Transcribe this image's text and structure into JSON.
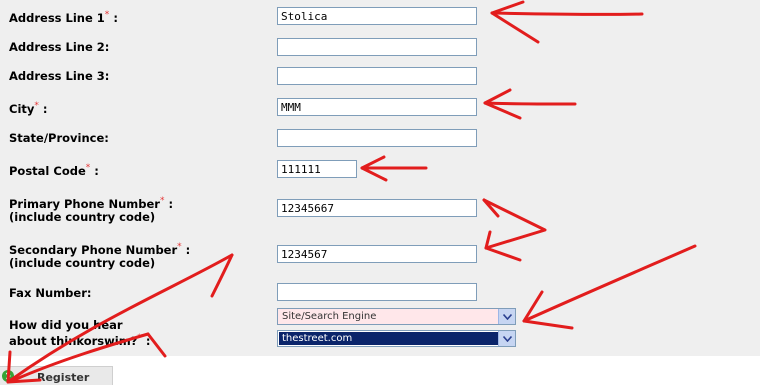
{
  "form": {
    "address1_label": "Address Line 1",
    "address1_value": "Stolica",
    "address2_label": "Address Line 2:",
    "address2_value": "",
    "address3_label": "Address Line 3:",
    "address3_value": "",
    "city_label": "City",
    "city_value": "MMM",
    "state_label": "State/Province:",
    "state_value": "",
    "postal_label": "Postal Code",
    "postal_value": "111111",
    "primary_phone_label_1": "Primary Phone Number",
    "primary_phone_label_2": "(include country code)",
    "primary_phone_value": "12345667",
    "secondary_phone_label_1": "Secondary Phone Number",
    "secondary_phone_label_2": "(include country code)",
    "secondary_phone_value": "1234567",
    "fax_label": "Fax Number:",
    "fax_value": "",
    "hear_label_1": "How did you hear",
    "hear_label_2": "about thinkorswim?",
    "hear_select_1": "Site/Search Engine",
    "hear_select_2": "thestreet.com",
    "required_mark": "*",
    "colon": ":"
  },
  "register_label": "Register",
  "colors": {
    "required": "#e53535",
    "arrow": "#e21d1d",
    "select_highlight_bg": "#ffe7ea",
    "select_selected_bg": "#0a246a"
  }
}
